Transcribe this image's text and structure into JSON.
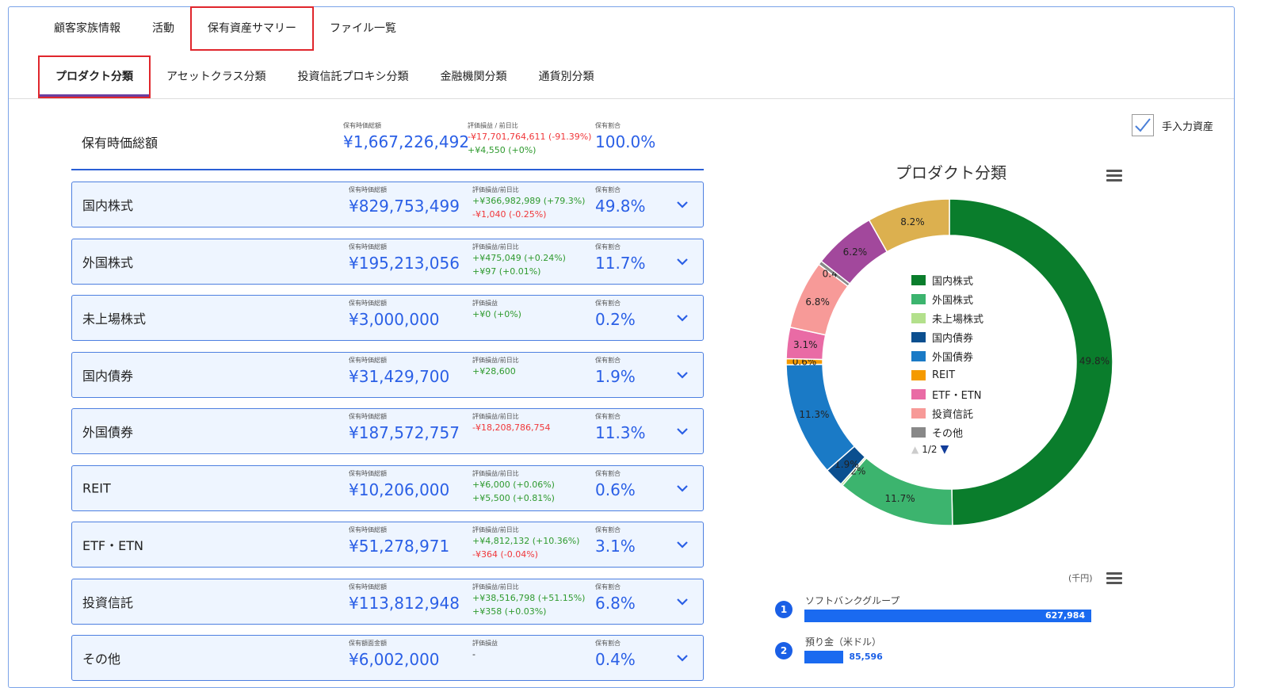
{
  "tabs": [
    {
      "label": "顧客家族情報"
    },
    {
      "label": "活動"
    },
    {
      "label": "保有資産サマリー",
      "selected": true
    },
    {
      "label": "ファイル一覧"
    }
  ],
  "subtabs": [
    {
      "label": "プロダクト分類",
      "selected": true
    },
    {
      "label": "アセットクラス分類"
    },
    {
      "label": "投資信託プロキシ分類"
    },
    {
      "label": "金融機関分類"
    },
    {
      "label": "通貨別分類"
    }
  ],
  "summary": {
    "name": "保有時価総額",
    "amount_label": "保有時価総額",
    "amount": "¥1,667,226,492",
    "pl_label": "評価損益 / 前日比",
    "pl": [
      {
        "text": "-¥17,701,764,611 (-91.39%)",
        "sign": "neg"
      },
      {
        "text": "+¥4,550 (+0%)",
        "sign": "pos"
      }
    ],
    "ratio_label": "保有割合",
    "ratio": "100.0%"
  },
  "rows": [
    {
      "name": "国内株式",
      "amount_label": "保有時価総額",
      "amount": "¥829,753,499",
      "pl_label": "評価損益/前日比",
      "pl": [
        {
          "text": "+¥366,982,989 (+79.3%)",
          "sign": "pos"
        },
        {
          "text": "-¥1,040 (-0.25%)",
          "sign": "neg"
        }
      ],
      "ratio_label": "保有割合",
      "ratio": "49.8%"
    },
    {
      "name": "外国株式",
      "amount_label": "保有時価総額",
      "amount": "¥195,213,056",
      "pl_label": "評価損益/前日比",
      "pl": [
        {
          "text": "+¥475,049 (+0.24%)",
          "sign": "pos"
        },
        {
          "text": "+¥97 (+0.01%)",
          "sign": "pos"
        }
      ],
      "ratio_label": "保有割合",
      "ratio": "11.7%"
    },
    {
      "name": "未上場株式",
      "amount_label": "保有時価総額",
      "amount": "¥3,000,000",
      "pl_label": "評価損益",
      "pl": [
        {
          "text": "+¥0 (+0%)",
          "sign": "pos"
        }
      ],
      "ratio_label": "保有割合",
      "ratio": "0.2%"
    },
    {
      "name": "国内債券",
      "amount_label": "保有時価総額",
      "amount": "¥31,429,700",
      "pl_label": "評価損益/前日比",
      "pl": [
        {
          "text": "+¥28,600",
          "sign": "pos"
        }
      ],
      "ratio_label": "保有割合",
      "ratio": "1.9%"
    },
    {
      "name": "外国債券",
      "amount_label": "保有時価総額",
      "amount": "¥187,572,757",
      "pl_label": "評価損益/前日比",
      "pl": [
        {
          "text": "-¥18,208,786,754",
          "sign": "neg"
        }
      ],
      "ratio_label": "保有割合",
      "ratio": "11.3%"
    },
    {
      "name": "REIT",
      "amount_label": "保有時価総額",
      "amount": "¥10,206,000",
      "pl_label": "評価損益/前日比",
      "pl": [
        {
          "text": "+¥6,000 (+0.06%)",
          "sign": "pos"
        },
        {
          "text": "+¥5,500 (+0.81%)",
          "sign": "pos"
        }
      ],
      "ratio_label": "保有割合",
      "ratio": "0.6%"
    },
    {
      "name": "ETF・ETN",
      "amount_label": "保有時価総額",
      "amount": "¥51,278,971",
      "pl_label": "評価損益/前日比",
      "pl": [
        {
          "text": "+¥4,812,132 (+10.36%)",
          "sign": "pos"
        },
        {
          "text": "-¥364 (-0.04%)",
          "sign": "neg"
        }
      ],
      "ratio_label": "保有割合",
      "ratio": "3.1%"
    },
    {
      "name": "投資信託",
      "amount_label": "保有時価総額",
      "amount": "¥113,812,948",
      "pl_label": "評価損益/前日比",
      "pl": [
        {
          "text": "+¥38,516,798 (+51.15%)",
          "sign": "pos"
        },
        {
          "text": "+¥358 (+0.03%)",
          "sign": "pos"
        }
      ],
      "ratio_label": "保有割合",
      "ratio": "6.8%"
    },
    {
      "name": "その他",
      "amount_label": "保有額面金額",
      "amount": "¥6,002,000",
      "pl_label": "評価損益",
      "pl": [
        {
          "text": "-",
          "sign": "none"
        }
      ],
      "ratio_label": "保有割合",
      "ratio": "0.4%"
    }
  ],
  "manual_asset": {
    "label": "手入力資産",
    "checked": true
  },
  "chart_data": [
    {
      "type": "pie",
      "title": "プロダクト分類",
      "donut": true,
      "slices": [
        {
          "name": "国内株式",
          "value": 49.8,
          "label": "49.8%",
          "color": "#0a7d2c"
        },
        {
          "name": "外国株式",
          "value": 11.7,
          "label": "11.7%",
          "color": "#3cb46e"
        },
        {
          "name": "未上場株式",
          "value": 0.2,
          "label": "0.2%",
          "color": "#b3e08c"
        },
        {
          "name": "国内債券",
          "value": 1.9,
          "label": "1.9%",
          "color": "#0b4f8f"
        },
        {
          "name": "外国債券",
          "value": 11.3,
          "label": "11.3%",
          "color": "#1a7ac6"
        },
        {
          "name": "REIT",
          "value": 0.6,
          "label": "0.6%",
          "color": "#f59a00"
        },
        {
          "name": "ETF・ETN",
          "value": 3.1,
          "label": "3.1%",
          "color": "#e96ba5"
        },
        {
          "name": "投資信託",
          "value": 6.8,
          "label": "6.8%",
          "color": "#f79a98"
        },
        {
          "name": "その他",
          "value": 0.4,
          "label": "0.4%",
          "color": "#888888"
        },
        {
          "value": 6.2,
          "label": "6.2%",
          "color": "#a2489c"
        },
        {
          "value": 8.2,
          "label": "8.2%",
          "color": "#dcb04f"
        }
      ],
      "legend_count": 9,
      "legend_page": "1/2",
      "legend_placement": "center"
    },
    {
      "type": "bar",
      "orientation": "horizontal",
      "unit": "(千円)",
      "bars": [
        {
          "rank": "1",
          "name": "ソフトバンクグループ",
          "value": 627984,
          "label": "627,984"
        },
        {
          "rank": "2",
          "name": "預り金（米ドル）",
          "value": 85596,
          "label": "85,596"
        }
      ],
      "color": "#1a6af0"
    }
  ]
}
